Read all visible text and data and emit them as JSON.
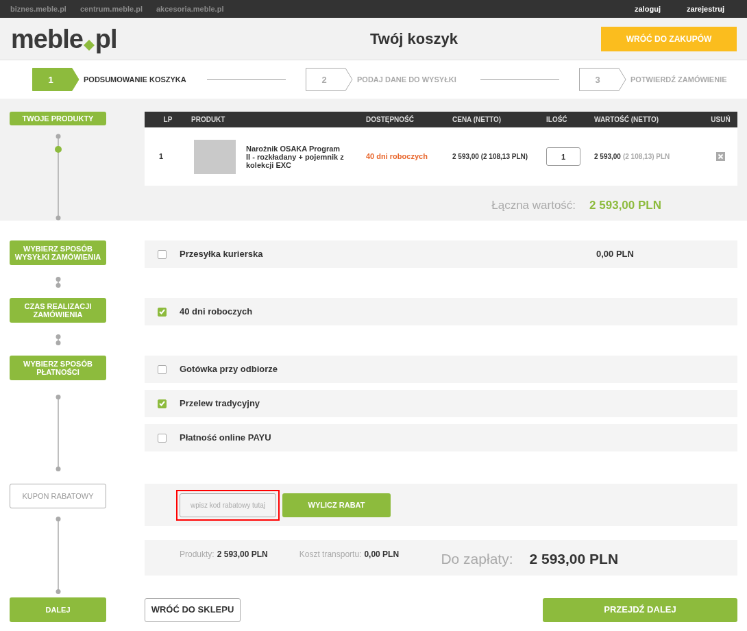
{
  "top_bar": {
    "links": [
      "biznes.meble.pl",
      "centrum.meble.pl",
      "akcesoria.meble.pl"
    ],
    "account_links": [
      "zaloguj",
      "zarejestruj"
    ]
  },
  "header": {
    "logo": [
      "meble",
      "pl"
    ],
    "title": "Twój koszyk",
    "back_button": "WRÓĆ DO ZAKUPÓW"
  },
  "steps": [
    {
      "number": "1",
      "label": "PODSUMOWANIE KOSZYKA",
      "selected": true
    },
    {
      "number": "2",
      "label": "PODAJ DANE DO WYSYŁKI",
      "selected": false
    },
    {
      "number": "3",
      "label": "POTWIERDŹ ZAMÓWIENIE",
      "selected": false
    }
  ],
  "products": {
    "section_label": "TWOJE PRODUKTY",
    "table": {
      "columns": [
        "LP",
        "PRODUKT",
        "DOSTĘPNOŚĆ",
        "CENA (NETTO)",
        "ILOŚĆ",
        "WARTOŚĆ (NETTO)",
        "USUŃ"
      ],
      "rows": [
        {
          "lp": "1",
          "name": "Narożnik OSAKA Program II - rozkładany + pojemnik z kolekcji EXC",
          "availability": "40 dni roboczych",
          "price": "2 593,00 (2 108,13 PLN)",
          "quantity": "1",
          "value": "2 593,00",
          "value_net": "(2 108,13) PLN"
        }
      ]
    },
    "total_label": "Łączna wartość:",
    "total_value": "2 593,00 PLN"
  },
  "option_groups": [
    {
      "section_label": "WYBIERZ SPOSÓB WYSYŁKI ZAMÓWIENIA",
      "options": [
        {
          "label": "Przesyłka kurierska",
          "checked": false,
          "price": "0,00 PLN"
        }
      ]
    },
    {
      "section_label": "CZAS REALIZACJI ZAMÓWIENIA",
      "options": [
        {
          "label": "40 dni roboczych",
          "checked": true
        }
      ]
    },
    {
      "section_label": "WYBIERZ SPOSÓB PŁATNOŚCI",
      "options": [
        {
          "label": "Gotówka przy odbiorze",
          "checked": false
        },
        {
          "label": "Przelew tradycyjny",
          "checked": true
        },
        {
          "label": "Płatność online PAYU",
          "checked": false
        }
      ]
    }
  ],
  "coupon": {
    "section_label": "KUPON RABATOWY",
    "placeholder": "wpisz kod rabatowy tutaj",
    "highlighted": true,
    "button": "WYLICZ RABAT"
  },
  "summary": {
    "products_label": "Produkty:",
    "products_value": "2 593,00 PLN",
    "transport_label": "Koszt transportu:",
    "transport_value": "0,00 PLN",
    "due_label": "Do zapłaty:",
    "due_value": "2 593,00 PLN"
  },
  "footer": {
    "section_label": "DALEJ",
    "back_button": "WRÓĆ DO SKLEPU",
    "next_button": "PRZEJDŹ DALEJ"
  }
}
